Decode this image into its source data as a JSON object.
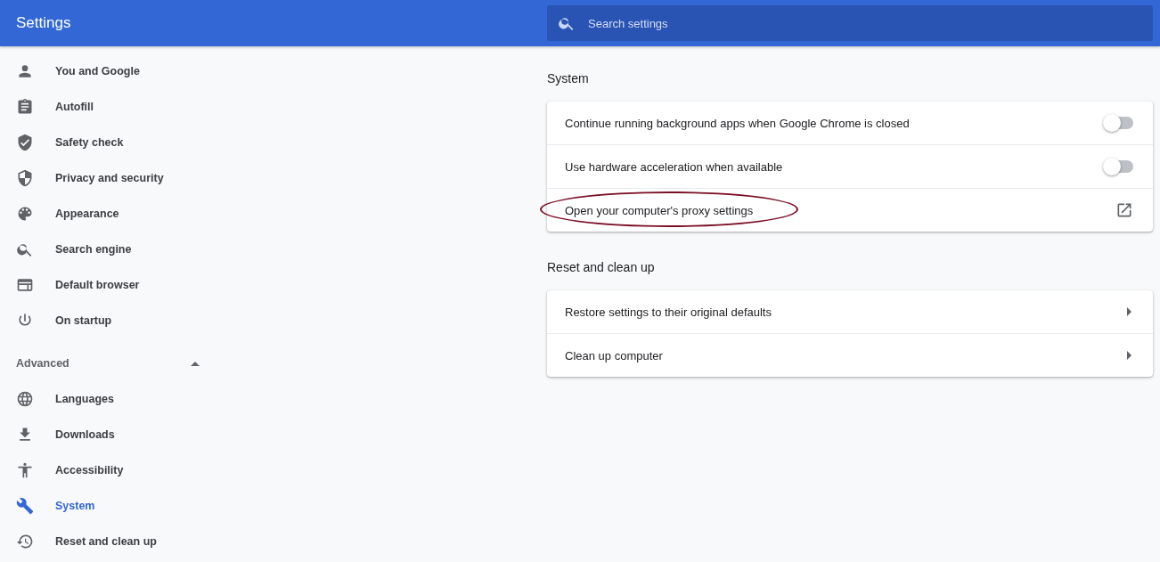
{
  "header": {
    "title": "Settings",
    "search": {
      "placeholder": "Search settings"
    }
  },
  "sidebar": {
    "items": [
      {
        "label": "You and Google",
        "selected": false
      },
      {
        "label": "Autofill",
        "selected": false
      },
      {
        "label": "Safety check",
        "selected": false
      },
      {
        "label": "Privacy and security",
        "selected": false
      },
      {
        "label": "Appearance",
        "selected": false
      },
      {
        "label": "Search engine",
        "selected": false
      },
      {
        "label": "Default browser",
        "selected": false
      },
      {
        "label": "On startup",
        "selected": false
      }
    ],
    "advanced": {
      "label": "Advanced",
      "expanded": true,
      "items": [
        {
          "label": "Languages",
          "selected": false
        },
        {
          "label": "Downloads",
          "selected": false
        },
        {
          "label": "Accessibility",
          "selected": false
        },
        {
          "label": "System",
          "selected": true
        },
        {
          "label": "Reset and clean up",
          "selected": false
        }
      ]
    }
  },
  "sections": [
    {
      "title": "System",
      "rows": [
        {
          "kind": "toggle",
          "label": "Continue running background apps when Google Chrome is closed",
          "on": false
        },
        {
          "kind": "toggle",
          "label": "Use hardware acceleration when available",
          "on": false
        },
        {
          "kind": "external",
          "label": "Open your computer's proxy settings"
        }
      ]
    },
    {
      "title": "Reset and clean up",
      "rows": [
        {
          "kind": "arrow",
          "label": "Restore settings to their original defaults"
        },
        {
          "kind": "arrow",
          "label": "Clean up computer"
        }
      ]
    }
  ]
}
